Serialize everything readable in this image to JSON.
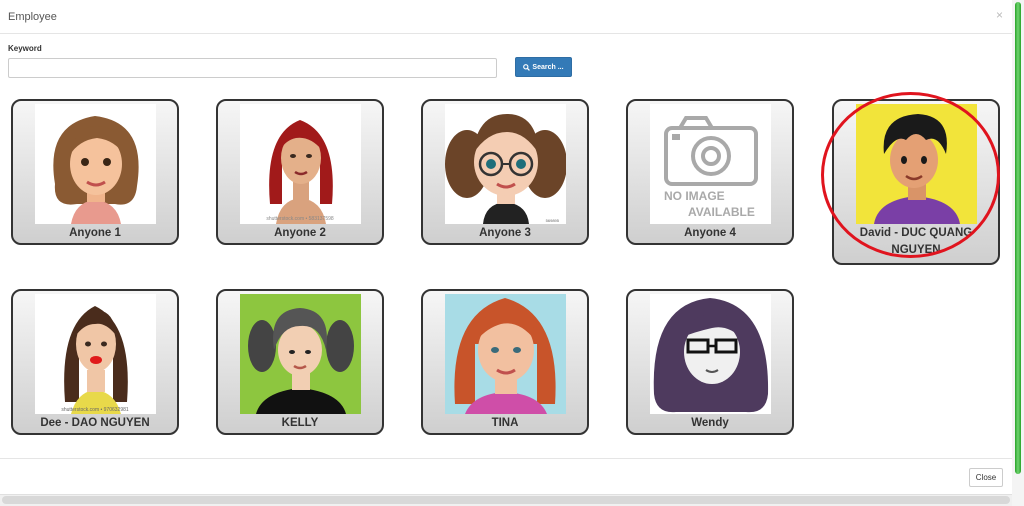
{
  "dialog": {
    "title": "Employee",
    "close_glyph": "×"
  },
  "search": {
    "keyword_label": "Keyword",
    "value": "",
    "placeholder": "",
    "button_label": "Search ...",
    "button_icon": "search-icon"
  },
  "employees": [
    {
      "name": "Anyone 1"
    },
    {
      "name": "Anyone 2",
      "photo_caption": "shutterstock.com • 583137598"
    },
    {
      "name": "Anyone 3",
      "photo_caption": "569895"
    },
    {
      "name": "Anyone 4",
      "no_image_line1": "NO IMAGE",
      "no_image_line2": "AVAILABLE"
    },
    {
      "name": "David - DUC QUANG",
      "name_line2": "NGUYEN"
    },
    {
      "name": "Dee - DAO NGUYEN",
      "photo_caption": "shutterstock.com • 970632981"
    },
    {
      "name": "KELLY"
    },
    {
      "name": "TINA"
    },
    {
      "name": "Wendy"
    }
  ],
  "footer": {
    "close_label": "Close"
  },
  "colors": {
    "accent": "#337ab7",
    "highlight_ring": "#e0141e",
    "scrollbar": "#29a329"
  }
}
